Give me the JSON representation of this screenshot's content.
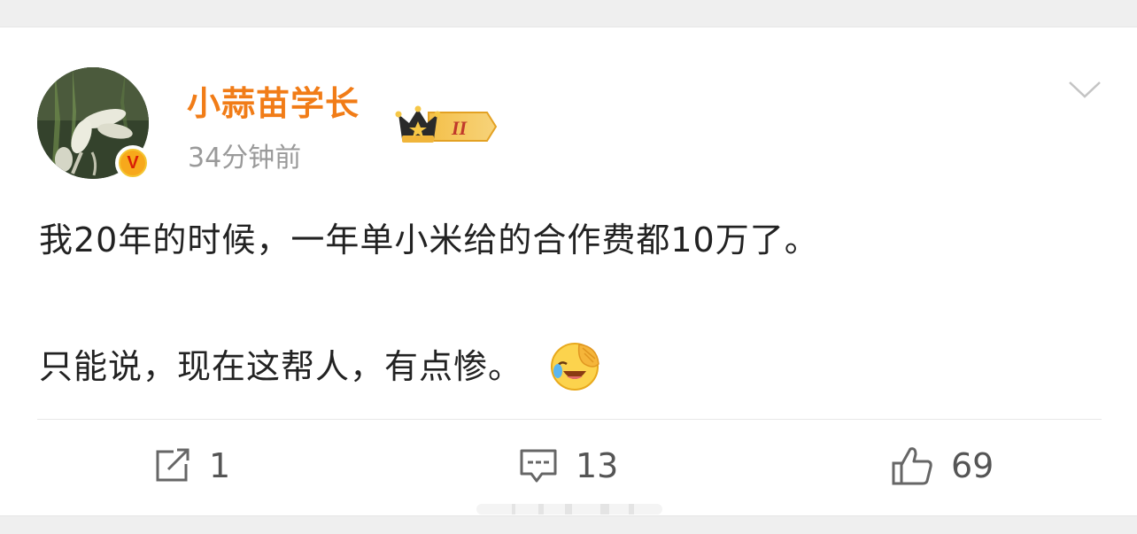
{
  "post": {
    "username": "小蒜苗学长",
    "level_badge": "II",
    "time": "34分钟前",
    "text_line1": "我20年的时候，一年单小米给的合作费都10万了。",
    "text_line2": "只能说，现在这帮人，有点惨。",
    "emoji": "laughing-crying-emoji",
    "username_color": "#f17c17"
  },
  "actions": {
    "repost_count": "1",
    "comment_count": "13",
    "like_count": "69"
  },
  "icons": [
    "v-verified-icon",
    "crown-icon",
    "chevron-down-icon",
    "repost-icon",
    "comment-icon",
    "like-icon"
  ]
}
